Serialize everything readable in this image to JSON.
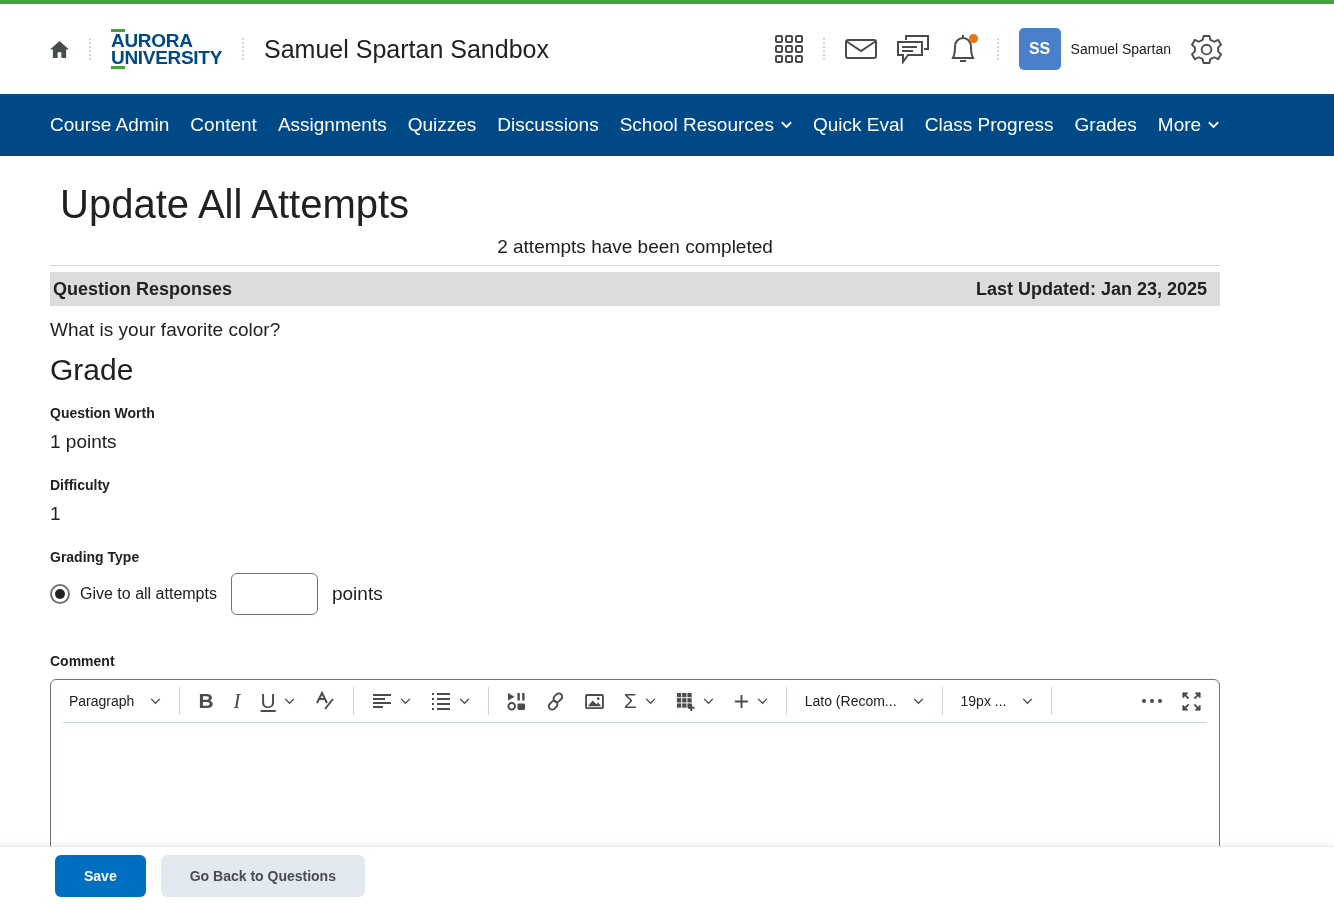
{
  "header": {
    "logo_top": "AURORA",
    "logo_bottom": "UNIVERSITY",
    "course_title": "Samuel Spartan Sandbox",
    "notification_unread": true,
    "avatar_initials": "SS",
    "user_name": "Samuel Spartan"
  },
  "nav": [
    {
      "label": "Course Admin",
      "dropdown": false
    },
    {
      "label": "Content",
      "dropdown": false
    },
    {
      "label": "Assignments",
      "dropdown": false
    },
    {
      "label": "Quizzes",
      "dropdown": false
    },
    {
      "label": "Discussions",
      "dropdown": false
    },
    {
      "label": "School Resources",
      "dropdown": true
    },
    {
      "label": "Quick Eval",
      "dropdown": false
    },
    {
      "label": "Class Progress",
      "dropdown": false
    },
    {
      "label": "Grades",
      "dropdown": false
    },
    {
      "label": "More",
      "dropdown": true
    }
  ],
  "page_title": "Update All Attempts",
  "attempts_note": "2 attempts have been completed",
  "section": {
    "title": "Question Responses",
    "updated": "Last Updated: Jan 23, 2025"
  },
  "question": "What is your favorite color?",
  "grade_heading": "Grade",
  "fields": [
    {
      "label": "Question Worth",
      "value": "1 points"
    },
    {
      "label": "Difficulty",
      "value": "1"
    }
  ],
  "grading_type": {
    "label": "Grading Type",
    "option": "Give to all attempts",
    "selected": true,
    "unit": "points"
  },
  "comment": {
    "label": "Comment",
    "toolbar": [
      {
        "kind": "select",
        "text": "Paragraph"
      },
      {
        "kind": "sep"
      },
      {
        "kind": "bold",
        "text": "B"
      },
      {
        "kind": "italic",
        "text": "I"
      },
      {
        "kind": "underline",
        "text": "U"
      },
      {
        "kind": "format"
      },
      {
        "kind": "sep"
      },
      {
        "kind": "align"
      },
      {
        "kind": "list"
      },
      {
        "kind": "sep"
      },
      {
        "kind": "media"
      },
      {
        "kind": "link"
      },
      {
        "kind": "image"
      },
      {
        "kind": "equation",
        "text": "Σ"
      },
      {
        "kind": "table"
      },
      {
        "kind": "plus"
      },
      {
        "kind": "sep"
      },
      {
        "kind": "select",
        "text": "Lato (Recom..."
      },
      {
        "kind": "sep"
      },
      {
        "kind": "select",
        "text": "19px ..."
      },
      {
        "kind": "sep"
      },
      {
        "kind": "spacer"
      },
      {
        "kind": "more"
      },
      {
        "kind": "fullscreen"
      }
    ]
  },
  "buttons": [
    {
      "label": "Save",
      "primary": true
    },
    {
      "label": "Go Back to Questions",
      "primary": false
    }
  ]
}
